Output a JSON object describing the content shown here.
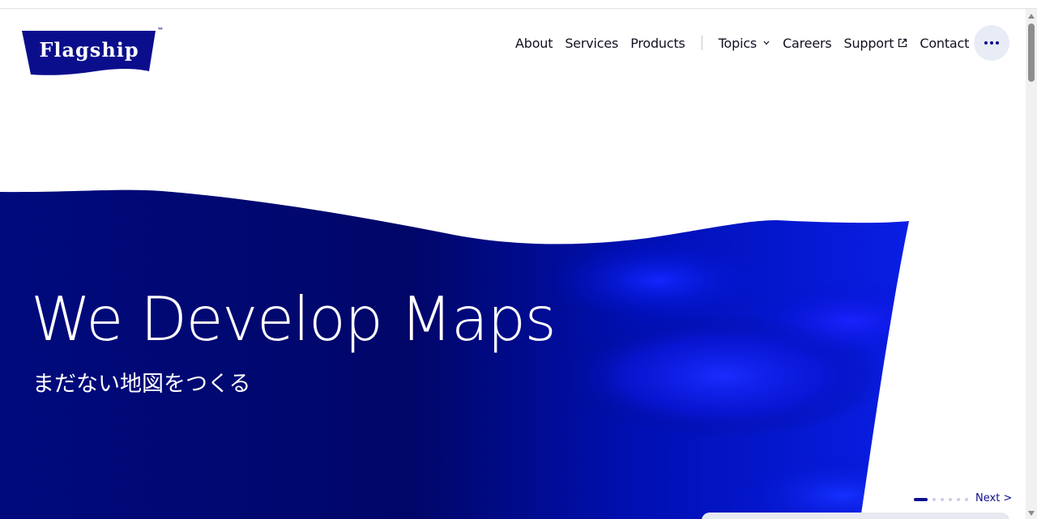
{
  "brand": {
    "logo_text": "Flagship",
    "trademark": "™",
    "primary_color": "#0b0e8c",
    "accent_color": "#0a1cf0"
  },
  "nav": {
    "items": [
      {
        "label": "About"
      },
      {
        "label": "Services"
      },
      {
        "label": "Products"
      },
      {
        "label": "Topics"
      },
      {
        "label": "Careers"
      },
      {
        "label": "Support"
      },
      {
        "label": "Contact"
      }
    ],
    "more_icon": "more-horizontal-icon"
  },
  "hero": {
    "title": "We Develop Maps",
    "subtitle": "まだない地図をつくる"
  },
  "carousel": {
    "next_label": "Next >",
    "slide_count": 6,
    "active_slide": 1
  }
}
